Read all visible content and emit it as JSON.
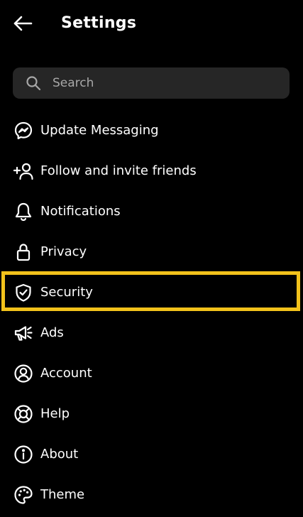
{
  "header": {
    "title": "Settings",
    "back_icon": "arrow-left-icon"
  },
  "search": {
    "placeholder": "Search",
    "icon": "search-icon"
  },
  "menu": {
    "items": [
      {
        "label": "Update Messaging",
        "icon": "messenger-icon"
      },
      {
        "label": "Follow and invite friends",
        "icon": "add-person-icon"
      },
      {
        "label": "Notifications",
        "icon": "bell-icon"
      },
      {
        "label": "Privacy",
        "icon": "lock-icon"
      },
      {
        "label": "Security",
        "icon": "shield-check-icon"
      },
      {
        "label": "Ads",
        "icon": "megaphone-icon"
      },
      {
        "label": "Account",
        "icon": "account-circle-icon"
      },
      {
        "label": "Help",
        "icon": "lifebuoy-icon"
      },
      {
        "label": "About",
        "icon": "info-icon"
      },
      {
        "label": "Theme",
        "icon": "palette-icon"
      }
    ]
  },
  "colors": {
    "background": "#000000",
    "search_background": "#262626",
    "text": "#ffffff",
    "placeholder": "#a8a8a8",
    "highlight": "#f2c21b"
  }
}
